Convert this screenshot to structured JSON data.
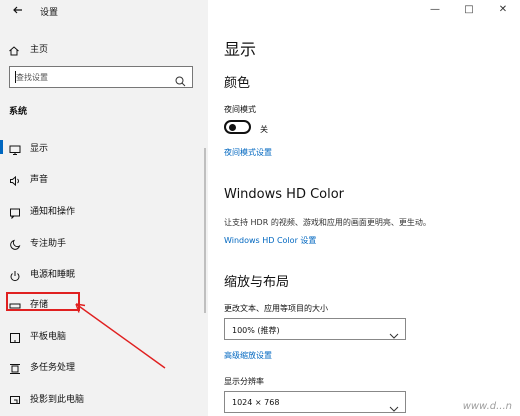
{
  "sidebar": {
    "app_title": "设置",
    "back_icon": "back-arrow-icon",
    "home": {
      "label": "主页",
      "icon": "home-icon"
    },
    "search": {
      "placeholder": "查找设置",
      "icon": "search-icon"
    },
    "section": "系统",
    "items": [
      {
        "label": "显示",
        "icon": "monitor-icon",
        "active": true
      },
      {
        "label": "声音",
        "icon": "speaker-icon"
      },
      {
        "label": "通知和操作",
        "icon": "notification-icon"
      },
      {
        "label": "专注助手",
        "icon": "moon-icon"
      },
      {
        "label": "电源和睡眠",
        "icon": "power-icon"
      },
      {
        "label": "存储",
        "icon": "storage-icon",
        "highlighted": true
      },
      {
        "label": "平板电脑",
        "icon": "tablet-icon"
      },
      {
        "label": "多任务处理",
        "icon": "multitask-icon"
      },
      {
        "label": "投影到此电脑",
        "icon": "project-icon"
      }
    ]
  },
  "window_controls": {
    "minimize": "—",
    "maximize": "□",
    "close": "✕"
  },
  "main": {
    "page_title": "显示",
    "color": {
      "heading": "颜色",
      "night_light_label": "夜间模式",
      "toggle_state": "关",
      "night_light_link": "夜间模式设置"
    },
    "hd_color": {
      "heading": "Windows HD Color",
      "description": "让支持 HDR 的视频、游戏和应用的画面更明亮、更生动。",
      "link": "Windows HD Color 设置"
    },
    "scale_layout": {
      "heading": "缩放与布局",
      "scale_label": "更改文本、应用等项目的大小",
      "scale_value": "100% (推荐)",
      "advanced_link": "高级缩放设置",
      "resolution_label": "显示分辨率",
      "resolution_value": "1024 × 768"
    }
  },
  "watermark": "www.d...n",
  "colors": {
    "accent": "#0067c0",
    "highlight": "#e02020",
    "sidebar_bg": "#f2f2f2"
  }
}
